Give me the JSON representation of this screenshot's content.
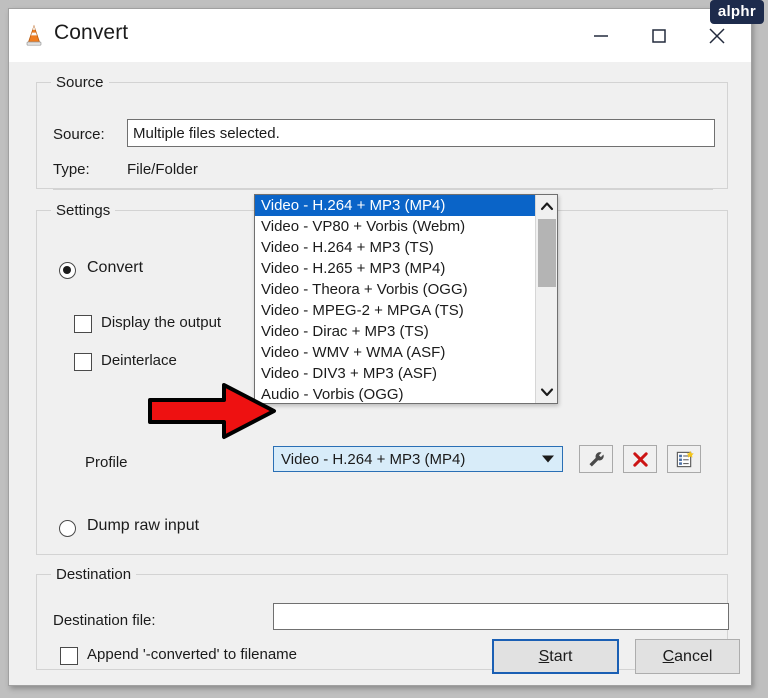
{
  "window": {
    "title": "Convert",
    "icon": "vlc-cone-icon",
    "controls": {
      "minimize": "minimize-icon",
      "maximize": "maximize-icon",
      "close": "close-icon"
    }
  },
  "watermark": {
    "text": "alphr"
  },
  "source": {
    "group_title": "Source",
    "source_label": "Source:",
    "source_value": "Multiple files selected.",
    "type_label": "Type:",
    "type_value": "File/Folder"
  },
  "settings": {
    "group_title": "Settings",
    "convert_label": "Convert",
    "display_output_label": "Display the output",
    "deinterlace_label": "Deinterlace",
    "profile_label": "Profile",
    "dump_raw_label": "Dump raw input",
    "selected_profile": "Video - H.264 + MP3 (MP4)",
    "tool_buttons": [
      {
        "name": "edit-profile-button",
        "icon": "wrench-icon"
      },
      {
        "name": "delete-profile-button",
        "icon": "red-x-icon"
      },
      {
        "name": "new-profile-button",
        "icon": "new-list-icon"
      }
    ],
    "profile_options": [
      "Video - H.264 + MP3 (MP4)",
      "Video - VP80 + Vorbis (Webm)",
      "Video - H.264 + MP3 (TS)",
      "Video - H.265 + MP3 (MP4)",
      "Video - Theora + Vorbis (OGG)",
      "Video - MPEG-2 + MPGA (TS)",
      "Video - Dirac + MP3 (TS)",
      "Video - WMV + WMA (ASF)",
      "Video - DIV3 + MP3 (ASF)",
      "Audio - Vorbis (OGG)"
    ],
    "selected_index": 0
  },
  "destination": {
    "group_title": "Destination",
    "dest_file_label": "Destination file:",
    "dest_file_value": "",
    "append_label": "Append '-converted' to filename"
  },
  "footer": {
    "start_accel": "S",
    "start_rest": "tart",
    "cancel_accel": "C",
    "cancel_rest": "ancel"
  },
  "annotation": {
    "arrow": "red-arrow-pointing-right",
    "color": "#ee1111"
  }
}
